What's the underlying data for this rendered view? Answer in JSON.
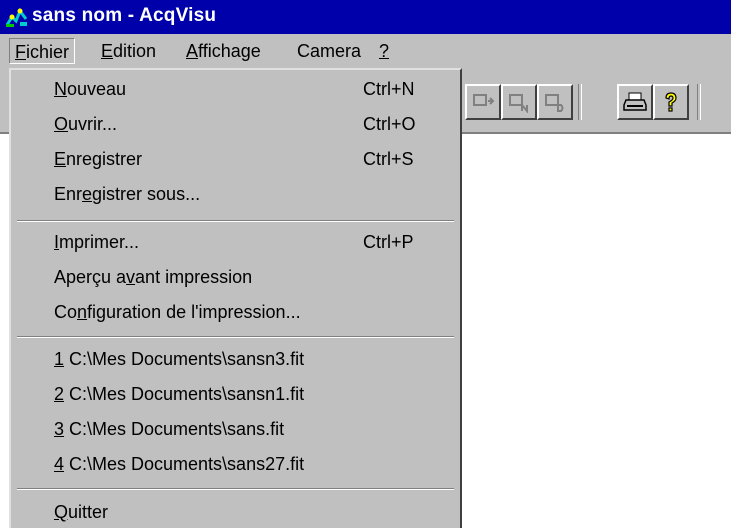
{
  "window": {
    "title": "sans nom - AcqVisu",
    "app_icon": "acqvisu-app-icon"
  },
  "menubar": [
    {
      "label": "Fichier",
      "mnemonic_index": 0,
      "active": true
    },
    {
      "label": "Edition",
      "mnemonic_index": 0,
      "active": false
    },
    {
      "label": "Affichage",
      "mnemonic_index": 0,
      "active": false
    },
    {
      "label": "Camera",
      "mnemonic_index": -1,
      "active": false
    },
    {
      "label": "?",
      "mnemonic_index": 0,
      "active": false
    }
  ],
  "toolbar": {
    "buttons": [
      {
        "icon": "camera-acquire-icon"
      },
      {
        "icon": "camera-acquire-n-icon"
      },
      {
        "icon": "camera-acquire-d-icon"
      },
      {
        "icon": "printer-icon"
      },
      {
        "icon": "help-question-icon"
      }
    ]
  },
  "fichier_menu": {
    "items": [
      {
        "label": "Nouveau",
        "mnemonic_index": 0,
        "shortcut": "Ctrl+N"
      },
      {
        "label": "Ouvrir...",
        "mnemonic_index": 0,
        "shortcut": "Ctrl+O"
      },
      {
        "label": "Enregistrer",
        "mnemonic_index": 0,
        "shortcut": "Ctrl+S"
      },
      {
        "label": "Enregistrer sous...",
        "mnemonic_index": 3,
        "shortcut": ""
      },
      {
        "separator": true
      },
      {
        "label": "Imprimer...",
        "mnemonic_index": 0,
        "shortcut": "Ctrl+P"
      },
      {
        "label": "Aperçu avant impression",
        "mnemonic_index": 8,
        "shortcut": ""
      },
      {
        "label": "Configuration de l'impression...",
        "mnemonic_index": 2,
        "shortcut": ""
      },
      {
        "separator": true
      },
      {
        "label": "1 C:\\Mes Documents\\sansn3.fit",
        "mnemonic_index": 0,
        "shortcut": ""
      },
      {
        "label": "2 C:\\Mes Documents\\sansn1.fit",
        "mnemonic_index": 0,
        "shortcut": ""
      },
      {
        "label": "3 C:\\Mes Documents\\sans.fit",
        "mnemonic_index": 0,
        "shortcut": ""
      },
      {
        "label": "4 C:\\Mes Documents\\sans27.fit",
        "mnemonic_index": 0,
        "shortcut": ""
      },
      {
        "separator": true
      },
      {
        "label": "Quitter",
        "mnemonic_index": 0,
        "shortcut": ""
      }
    ]
  },
  "colors": {
    "titlebar": "#0000aa",
    "face": "#c0c0c0",
    "workspace": "#ffffff"
  }
}
